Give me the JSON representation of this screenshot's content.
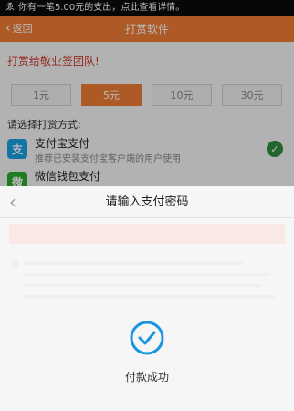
{
  "statusbar": {
    "icon": "notification-icon",
    "text": "你有一笔5.00元的支出，点此查看详情。"
  },
  "nav": {
    "back_label": "返回",
    "title": "打赏软件"
  },
  "reward": {
    "thanks": "打赏给敬业签团队!",
    "amounts": [
      "1元",
      "5元",
      "10元",
      "30元"
    ],
    "selected_amount": "5元",
    "pay_method_label": "请选择打赏方式:",
    "methods": [
      {
        "name": "支付宝支付",
        "desc": "推荐已安装支付宝客户端的用户使用",
        "icon": "alipay-icon",
        "selected": true
      },
      {
        "name": "微信钱包支付",
        "desc": "",
        "icon": "wechat-pay-icon",
        "selected": false
      }
    ]
  },
  "sheet": {
    "title": "请输入支付密码",
    "success_text": "付款成功"
  },
  "colors": {
    "accent": "#f07d36",
    "alipay": "#1aa1e6",
    "wechat": "#2aae30",
    "success": "#1996e1"
  }
}
